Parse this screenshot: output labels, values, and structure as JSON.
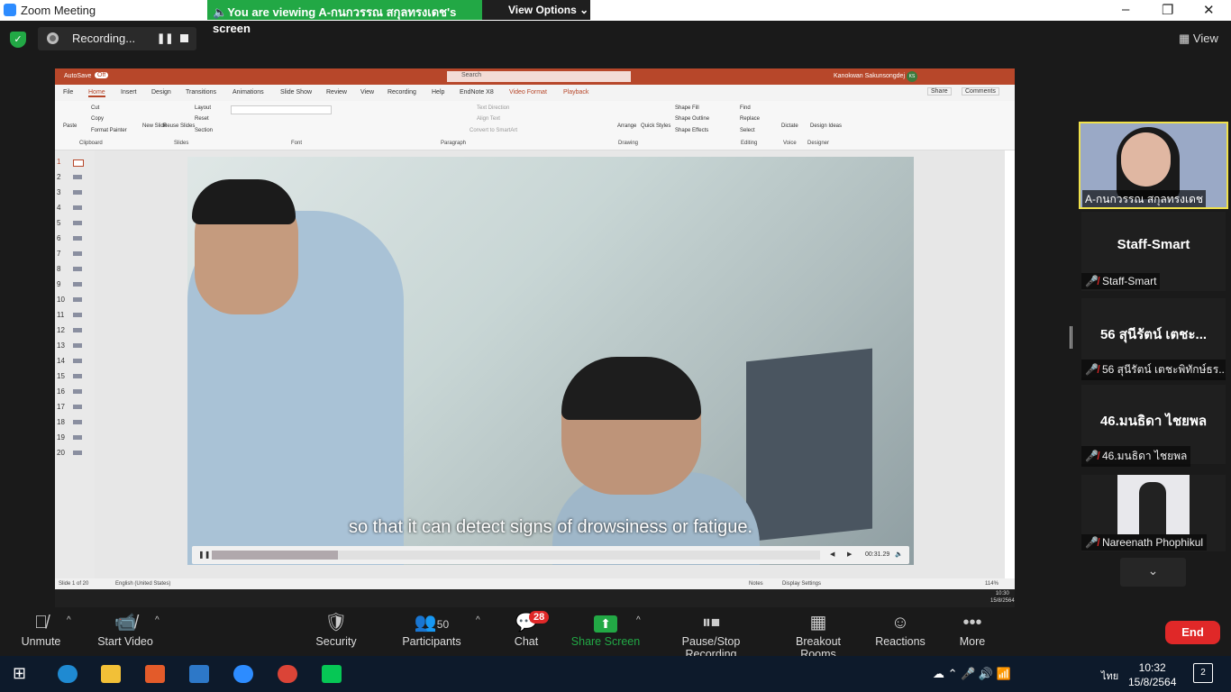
{
  "window": {
    "title": "Zoom Meeting"
  },
  "banner": {
    "viewing": "You are viewing A-กนกวรรณ สกุลทรงเดช's screen",
    "view_options": "View Options"
  },
  "top": {
    "recording_label": "Recording...",
    "view_label": "View"
  },
  "ppt": {
    "autosave": "AutoSave",
    "autosave_state": "Off",
    "search": "Search",
    "user": "Kanokwan Sakunsongdej",
    "user_initials": "KS",
    "tabs": [
      "File",
      "Home",
      "Insert",
      "Design",
      "Transitions",
      "Animations",
      "Slide Show",
      "Review",
      "View",
      "Recording",
      "Help",
      "EndNote X8",
      "Video Format",
      "Playback"
    ],
    "share": "Share",
    "comments": "Comments",
    "groups": [
      "Clipboard",
      "Slides",
      "Font",
      "Paragraph",
      "Drawing",
      "Editing",
      "Voice",
      "Designer"
    ],
    "ribbon_items": [
      "Paste",
      "Cut",
      "Copy",
      "Format Painter",
      "New Slide",
      "Reuse Slides",
      "Layout",
      "Reset",
      "Section",
      "Text Direction",
      "Align Text",
      "Convert to SmartArt",
      "Arrange",
      "Quick Styles",
      "Shape Fill",
      "Shape Outline",
      "Shape Effects",
      "Find",
      "Replace",
      "Select",
      "Dictate",
      "Design Ideas"
    ],
    "slide_numbers": [
      "1",
      "2",
      "3",
      "4",
      "5",
      "6",
      "7",
      "8",
      "9",
      "10",
      "11",
      "12",
      "13",
      "14",
      "15",
      "16",
      "17",
      "18",
      "19",
      "20"
    ],
    "subtitle": "so that it can detect signs of drowsiness or fatigue.",
    "video_time": "00:31.29",
    "status_left": "Slide 1 of 20",
    "status_lang": "English (United States)",
    "notes": "Notes",
    "display_settings": "Display Settings",
    "zoom": "114%",
    "os_time": "10:30",
    "os_date": "15/8/2564"
  },
  "participants": {
    "active_speaker": "A-กนกวรรณ สกุลทรงเดช",
    "tiles": [
      {
        "big": "Staff-Smart",
        "label": "Staff-Smart"
      },
      {
        "big": "56 สุนีรัตน์ เตชะ...",
        "label": "56 สุนีรัตน์ เตชะพิทักษ์ธร..."
      },
      {
        "big": "46.มนธิดา ไชยพล",
        "label": "46.มนธิดา ไชยพล"
      }
    ],
    "video_tile": "Nareenath Phophikul"
  },
  "toolbar": {
    "unmute": "Unmute",
    "start_video": "Start Video",
    "security": "Security",
    "participants": "Participants",
    "participant_count": "50",
    "chat": "Chat",
    "chat_badge": "28",
    "share_screen": "Share Screen",
    "pause_stop": "Pause/Stop Recording",
    "breakout": "Breakout Rooms",
    "reactions": "Reactions",
    "more": "More",
    "end": "End"
  },
  "taskbar": {
    "time": "10:32",
    "date": "15/8/2564",
    "lang": "ไทย",
    "notifications": "2"
  }
}
